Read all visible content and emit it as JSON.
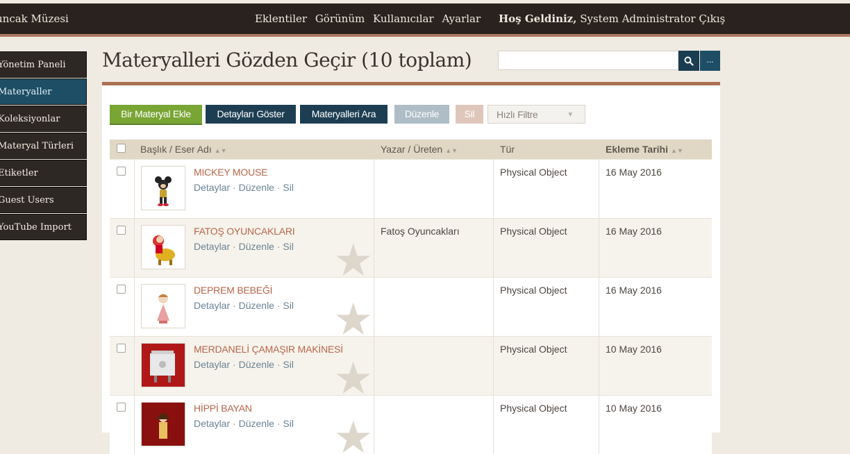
{
  "header": {
    "site_title": "uncak Müzesi",
    "nav": [
      "Eklentiler",
      "Görünüm",
      "Kullanıcılar",
      "Ayarlar"
    ],
    "welcome_label": "Hoş Geldiniz,",
    "user_name": "System Administrator",
    "logout": "Çıkış"
  },
  "sidebar": {
    "items": [
      {
        "label": "Yönetim Paneli"
      },
      {
        "label": "Materyaller"
      },
      {
        "label": "Koleksiyonlar"
      },
      {
        "label": "Materyal Türleri"
      },
      {
        "label": "Etiketler"
      },
      {
        "label": "Guest Users"
      },
      {
        "label": "YouTube Import"
      }
    ]
  },
  "page": {
    "title": "Materyalleri Gözden Geçir (10 toplam)"
  },
  "search": {
    "placeholder": "",
    "button_icon": "search-icon",
    "more_label": "..."
  },
  "toolbar": {
    "add": "Bir Materyal Ekle",
    "details": "Detayları Göster",
    "search": "Materyalleri Ara",
    "edit": "Düzenle",
    "delete": "Sil",
    "filter": "Hızlı Filtre"
  },
  "table": {
    "headers": {
      "title": "Başlık / Eser Adı",
      "author": "Yazar / Üreten",
      "type": "Tür",
      "date": "Ekleme Tarihi"
    },
    "row_links": {
      "details": "Detaylar",
      "edit": "Düzenle",
      "delete": "Sil"
    },
    "rows": [
      {
        "title": "MICKEY MOUSE",
        "author": "",
        "type": "Physical Object",
        "date": "16 May 2016"
      },
      {
        "title": "FATOŞ OYUNCAKLARI",
        "author": "Fatoş Oyuncakları",
        "type": "Physical Object",
        "date": "16 May 2016"
      },
      {
        "title": "DEPREM BEBEĞİ",
        "author": "",
        "type": "Physical Object",
        "date": "16 May 2016"
      },
      {
        "title": "MERDANELİ ÇAMAŞIR MAKİNESİ",
        "author": "",
        "type": "Physical Object",
        "date": "10 May 2016"
      },
      {
        "title": "HİPPİ BAYAN",
        "author": "",
        "type": "Physical Object",
        "date": "10 May 2016"
      }
    ]
  },
  "colors": {
    "accent": "#ab6f52",
    "nav_dark": "#2a221e",
    "active_blue": "#1d4e66",
    "add_green": "#79a534",
    "link_title": "#b8654a"
  }
}
